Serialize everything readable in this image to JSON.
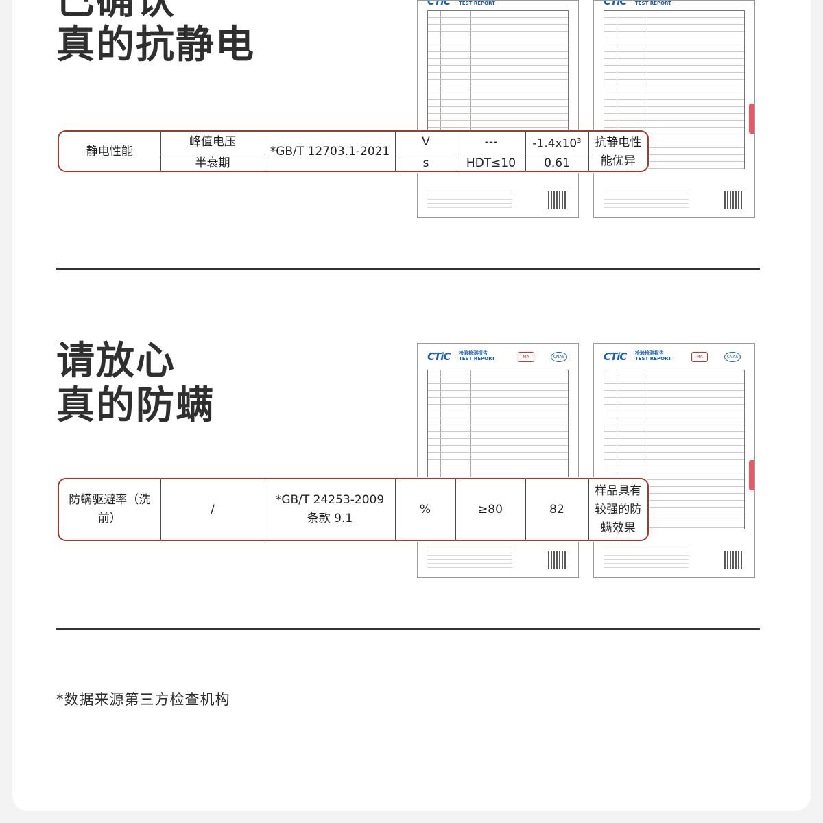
{
  "section1": {
    "title_line1": "已确认",
    "title_line2": "真的抗静电",
    "table": {
      "item": "静电性能",
      "sub_rows": [
        {
          "name": "峰值电压",
          "unit": "V",
          "requirement": "---",
          "result_base": "-1.4x10",
          "result_exp": "3"
        },
        {
          "name": "半衰期",
          "unit": "s",
          "requirement": "HDT≤10",
          "result_base": "0.61",
          "result_exp": ""
        }
      ],
      "standard": "*GB/T 12703.1-2021",
      "conclusion_line1": "抗静电性",
      "conclusion_line2": "能优异"
    }
  },
  "section2": {
    "title_line1": "请放心",
    "title_line2": "真的防螨",
    "table": {
      "item_line1": "防螨驱避率（洗",
      "item_line2": "前）",
      "sub_item": "/",
      "standard_line1": "*GB/T 24253-2009",
      "standard_line2": "条款 9.1",
      "unit": "%",
      "requirement": "≥80",
      "result": "82",
      "conclusion_line1": "样品具有",
      "conclusion_line2": "较强的防",
      "conclusion_line3": "螨效果"
    }
  },
  "report": {
    "logo": "CTiC",
    "logo_title": "检验检测报告",
    "logo_sub": "TEST REPORT",
    "cert1": "MA",
    "cert2": "CNAS"
  },
  "footnote": "*数据来源第三方检查机构",
  "colors": {
    "accent_border": "#a33a2c",
    "heading": "#2f2f2f",
    "logo_blue": "#1d5fb3"
  }
}
